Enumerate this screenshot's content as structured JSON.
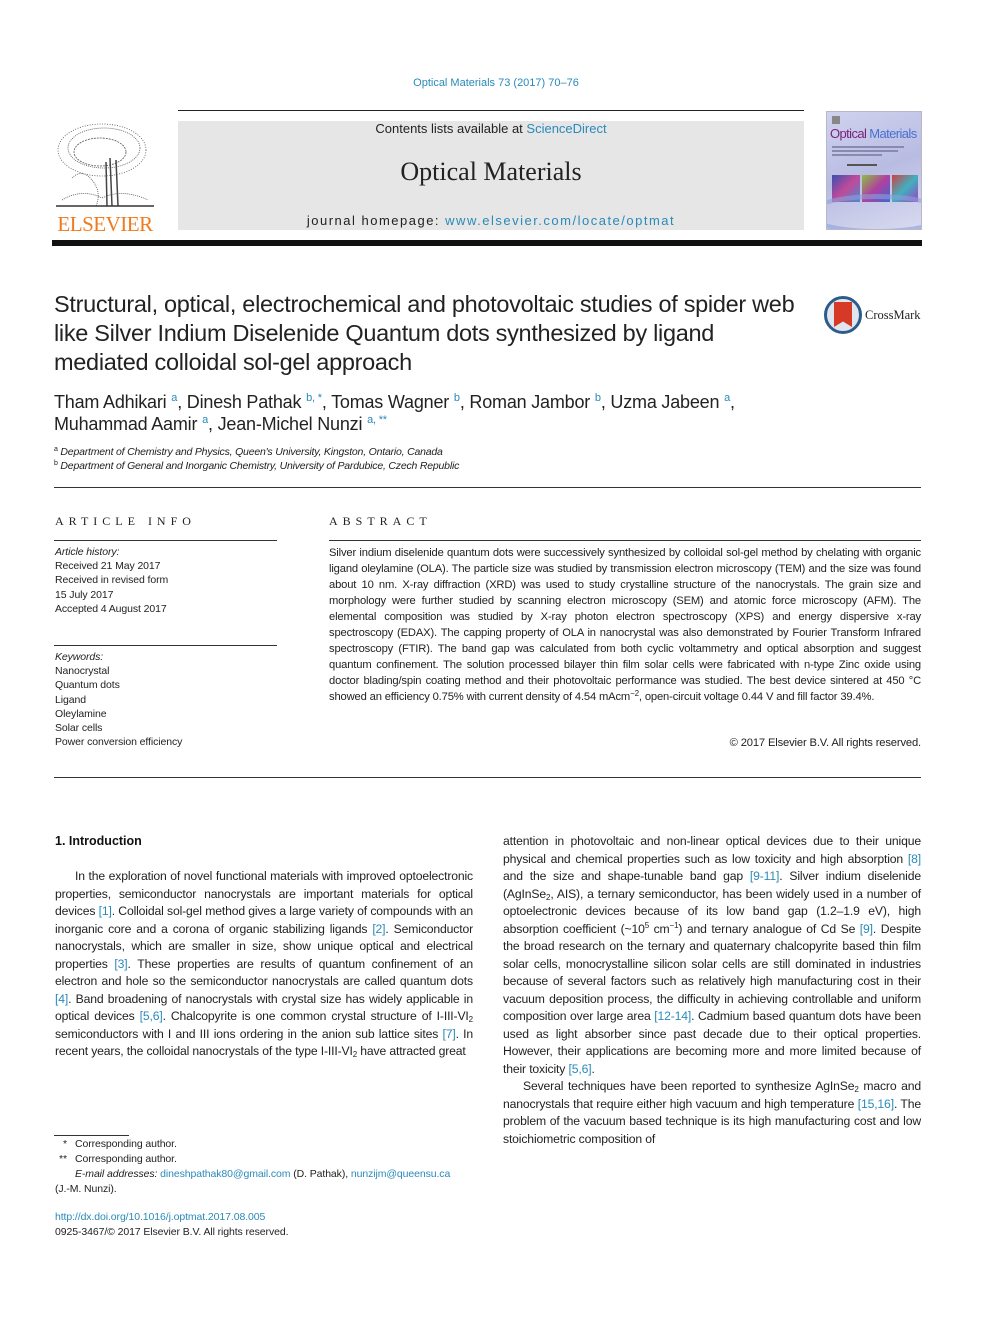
{
  "citation": "Optical Materials 73 (2017) 70–76",
  "header": {
    "publisher_logo_text": "ELSEVIER",
    "contents_prefix": "Contents lists available at ",
    "contents_link": "ScienceDirect",
    "journal_name": "Optical Materials",
    "homepage_prefix": "journal homepage: ",
    "homepage_link": "www.elsevier.com/locate/optmat",
    "cover_title_part1": "Optical",
    "cover_title_part2": " Materials"
  },
  "article": {
    "title": "Structural, optical, electrochemical and photovoltaic studies of spider web like Silver Indium Diselenide Quantum dots synthesized by ligand mediated colloidal sol-gel approach",
    "crossmark_label": "CrossMark",
    "authors": [
      {
        "name": "Tham Adhikari",
        "aff": "a",
        "sep": ", "
      },
      {
        "name": "Dinesh Pathak",
        "aff": "b, *",
        "sep": ", "
      },
      {
        "name": "Tomas Wagner",
        "aff": "b",
        "sep": ", "
      },
      {
        "name": "Roman Jambor",
        "aff": "b",
        "sep": ", "
      },
      {
        "name": "Uzma Jabeen",
        "aff": "a",
        "sep": ","
      },
      {
        "name": "Muhammad Aamir",
        "aff": "a",
        "sep": ", "
      },
      {
        "name": "Jean-Michel Nunzi",
        "aff": "a, **",
        "sep": ""
      }
    ],
    "affiliations": [
      {
        "mark": "a",
        "text": "Department of Chemistry and Physics, Queen's University, Kingston, Ontario, Canada"
      },
      {
        "mark": "b",
        "text": "Department of General and Inorganic Chemistry, University of Pardubice, Czech Republic"
      }
    ]
  },
  "article_info": {
    "heading": "ARTICLE INFO",
    "history_label": "Article history:",
    "history": [
      "Received 21 May 2017",
      "Received in revised form",
      "15 July 2017",
      "Accepted 4 August 2017"
    ],
    "keywords_label": "Keywords:",
    "keywords": [
      "Nanocrystal",
      "Quantum dots",
      "Ligand",
      "Oleylamine",
      "Solar cells",
      "Power conversion efficiency"
    ]
  },
  "abstract": {
    "heading": "ABSTRACT",
    "text_main": "Silver indium diselenide quantum dots were successively synthesized by colloidal sol-gel method by chelating with organic ligand oleylamine (OLA). The particle size was studied by transmission electron microscopy (TEM) and the size was found about 10 nm. X-ray diffraction (XRD) was used to study crystalline structure of the nanocrystals. The grain size and morphology were further studied by scanning electron microscopy (SEM) and atomic force microscopy (AFM). The elemental composition was studied by X-ray photon electron spectroscopy (XPS) and energy dispersive x-ray spectroscopy (EDAX). The capping property of OLA in nanocrystal was also demonstrated by Fourier Transform Infrared spectroscopy (FTIR). The band gap was calculated from both cyclic voltammetry and optical absorption and suggest quantum confinement. The solution processed bilayer thin film solar cells were fabricated with n-type Zinc oxide using doctor blading/spin coating method and their photovoltaic performance was studied. The best device sintered at 450 °C showed an efficiency 0.75% with current density of 4.54 mAcm",
    "text_sup": "−2",
    "text_end": ", open-circuit voltage 0.44 V and fill factor 39.4%.",
    "copyright": "© 2017 Elsevier B.V. All rights reserved."
  },
  "introduction": {
    "heading": "1.  Introduction",
    "left_column": {
      "p1_a": "In the exploration of novel functional materials with improved optoelectronic properties, semiconductor nanocrystals are important materials for optical devices ",
      "ref1": "[1]",
      "p1_b": ". Colloidal sol-gel method gives a large variety of compounds with an inorganic core and a corona of organic stabilizing ligands ",
      "ref2": "[2]",
      "p1_c": ". Semiconductor nanocrystals, which are smaller in size, show unique optical and electrical properties ",
      "ref3": "[3]",
      "p1_d": ". These properties are results of quantum confinement of an electron and hole so the semiconductor nanocrystals are called quantum dots ",
      "ref4": "[4]",
      "p1_e": ". Band broadening of nanocrystals with crystal size has widely applicable in optical devices ",
      "ref5": "[5,6]",
      "p1_f": ". Chalcopyrite is one common crystal structure of I-III-VI",
      "sub1": "2",
      "p1_g": " semiconductors with I and III ions ordering in the anion sub lattice sites ",
      "ref6": "[7]",
      "p1_h": ". In recent years, the colloidal nanocrystals of the type I-III-VI",
      "sub2": "2",
      "p1_i": " have attracted great"
    },
    "right_column": {
      "r1_a": "attention in photovoltaic and non-linear optical devices due to their unique physical and chemical properties such as low toxicity and high absorption ",
      "ref8": "[8]",
      "r1_b": " and the size and shape-tunable band gap ",
      "ref9": "[9-11]",
      "r1_c": ". Silver indium diselenide (AgInSe",
      "sub1": "2",
      "r1_d": ", AIS), a ternary semiconductor, has been widely used in a number of optoelectronic devices because of its low band gap (1.2–1.9 eV), high absorption coefficient (~10",
      "sup1": "5",
      "r1_e": " cm",
      "sup2": "−1",
      "r1_f": ") and ternary analogue of Cd Se ",
      "ref10": "[9]",
      "r1_g": ". Despite the broad research on the ternary and quaternary chalcopyrite based thin film solar cells, monocrystalline silicon solar cells are still dominated in industries because of several factors such as relatively high manufacturing cost in their vacuum deposition process, the difficulty in achieving controllable and uniform composition over large area ",
      "ref11": "[12-14]",
      "r1_h": ". Cadmium based quantum dots have been used as light absorber since past decade due to their optical properties. However, their applications are becoming more and more limited because of their toxicity ",
      "ref12": "[5,6]",
      "r1_i": ".",
      "r2_a": "Several techniques have been reported to synthesize AgInSe",
      "sub2": "2",
      "r2_b": " macro and nanocrystals that require either high vacuum and high temperature ",
      "ref13": "[15,16]",
      "r2_c": ". The problem of the vacuum based technique is its high manufacturing cost and low stoichiometric composition of"
    }
  },
  "footnotes": {
    "fn1_mark": "*",
    "fn1_text": "Corresponding author.",
    "fn2_mark": "**",
    "fn2_text": "Corresponding author.",
    "email_label": "E-mail addresses: ",
    "email1": "dineshpathak80@gmail.com",
    "email1_owner": " (D. Pathak), ",
    "email2": "nunzijm@queensu.ca",
    "email2_owner": "(J.-M. Nunzi).",
    "doi": "http://dx.doi.org/10.1016/j.optmat.2017.08.005",
    "issn_line": "0925-3467/© 2017 Elsevier B.V. All rights reserved."
  },
  "colors": {
    "link": "#2a8ab8",
    "elsevier_orange": "#f07a1e",
    "banner_gray": "#e6e6e6"
  }
}
